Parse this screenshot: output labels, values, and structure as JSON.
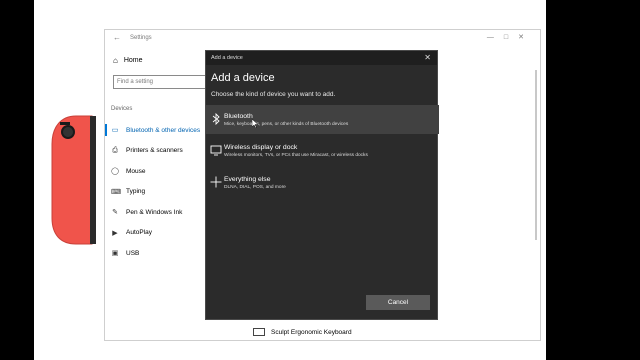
{
  "settings": {
    "title": "Settings",
    "home": "Home",
    "search_placeholder": "Find a setting",
    "section": "Devices",
    "items": [
      {
        "label": "Bluetooth & other devices",
        "icon": "bluetooth-devices-icon"
      },
      {
        "label": "Printers & scanners",
        "icon": "printer-icon"
      },
      {
        "label": "Mouse",
        "icon": "mouse-icon"
      },
      {
        "label": "Typing",
        "icon": "keyboard-icon"
      },
      {
        "label": "Pen & Windows Ink",
        "icon": "pen-icon"
      },
      {
        "label": "AutoPlay",
        "icon": "autoplay-icon"
      },
      {
        "label": "USB",
        "icon": "usb-icon"
      }
    ],
    "keyboard_item": "Sculpt Ergonomic Keyboard"
  },
  "dialog": {
    "window_title": "Add a device",
    "heading": "Add a device",
    "subtitle": "Choose the kind of device you want to add.",
    "options": [
      {
        "title": "Bluetooth",
        "desc": "Mice, keyboards, pens, or other kinds of Bluetooth devices",
        "icon": "bluetooth-icon"
      },
      {
        "title": "Wireless display or dock",
        "desc": "Wireless monitors, TVs, or PCs that use Miracast, or wireless docks",
        "icon": "monitor-icon"
      },
      {
        "title": "Everything else",
        "desc": "DLNA, DIAL, POS, and more",
        "icon": "plus-icon"
      }
    ],
    "cancel": "Cancel"
  },
  "colors": {
    "accent": "#0078d7",
    "joycon": "#f0544b",
    "dialog_bg": "#2b2b2b"
  }
}
